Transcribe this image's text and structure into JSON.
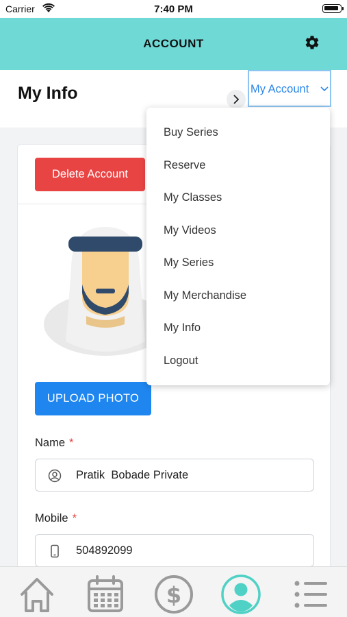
{
  "status_bar": {
    "carrier": "Carrier",
    "time": "7:40 PM"
  },
  "header": {
    "title": "ACCOUNT",
    "settings_icon": "gear-icon"
  },
  "subheader": {
    "page_title": "My Info",
    "menu_button_label": "My Account"
  },
  "card": {
    "delete_button": "Delete Account",
    "upload_button": "UPLOAD PHOTO",
    "fields": [
      {
        "label": "Name",
        "required_mark": "*",
        "value": "Pratik  Bobade Private",
        "icon": "user-circle-icon"
      },
      {
        "label": "Mobile",
        "required_mark": "*",
        "value": "504892099",
        "icon": "mobile-phone-icon"
      }
    ]
  },
  "dropdown": {
    "items": [
      "Buy Series",
      "Reserve",
      "My Classes",
      "My Videos",
      "My Series",
      "My Merchandise",
      "My Info",
      "Logout"
    ]
  },
  "tab_bar": {
    "tabs": [
      {
        "name": "home",
        "icon": "home-icon",
        "active": false
      },
      {
        "name": "calendar",
        "icon": "calendar-icon",
        "active": false
      },
      {
        "name": "payments",
        "icon": "dollar-icon",
        "active": false
      },
      {
        "name": "account",
        "icon": "user-icon",
        "active": true
      },
      {
        "name": "menu",
        "icon": "list-menu-icon",
        "active": false
      }
    ]
  },
  "colors": {
    "header_bg": "#6fd9d6",
    "delete": "#e94444",
    "upload": "#1f86f0",
    "link": "#2a86e8",
    "tab_inactive": "#9a9a9a",
    "tab_active": "#4fd1c5"
  }
}
